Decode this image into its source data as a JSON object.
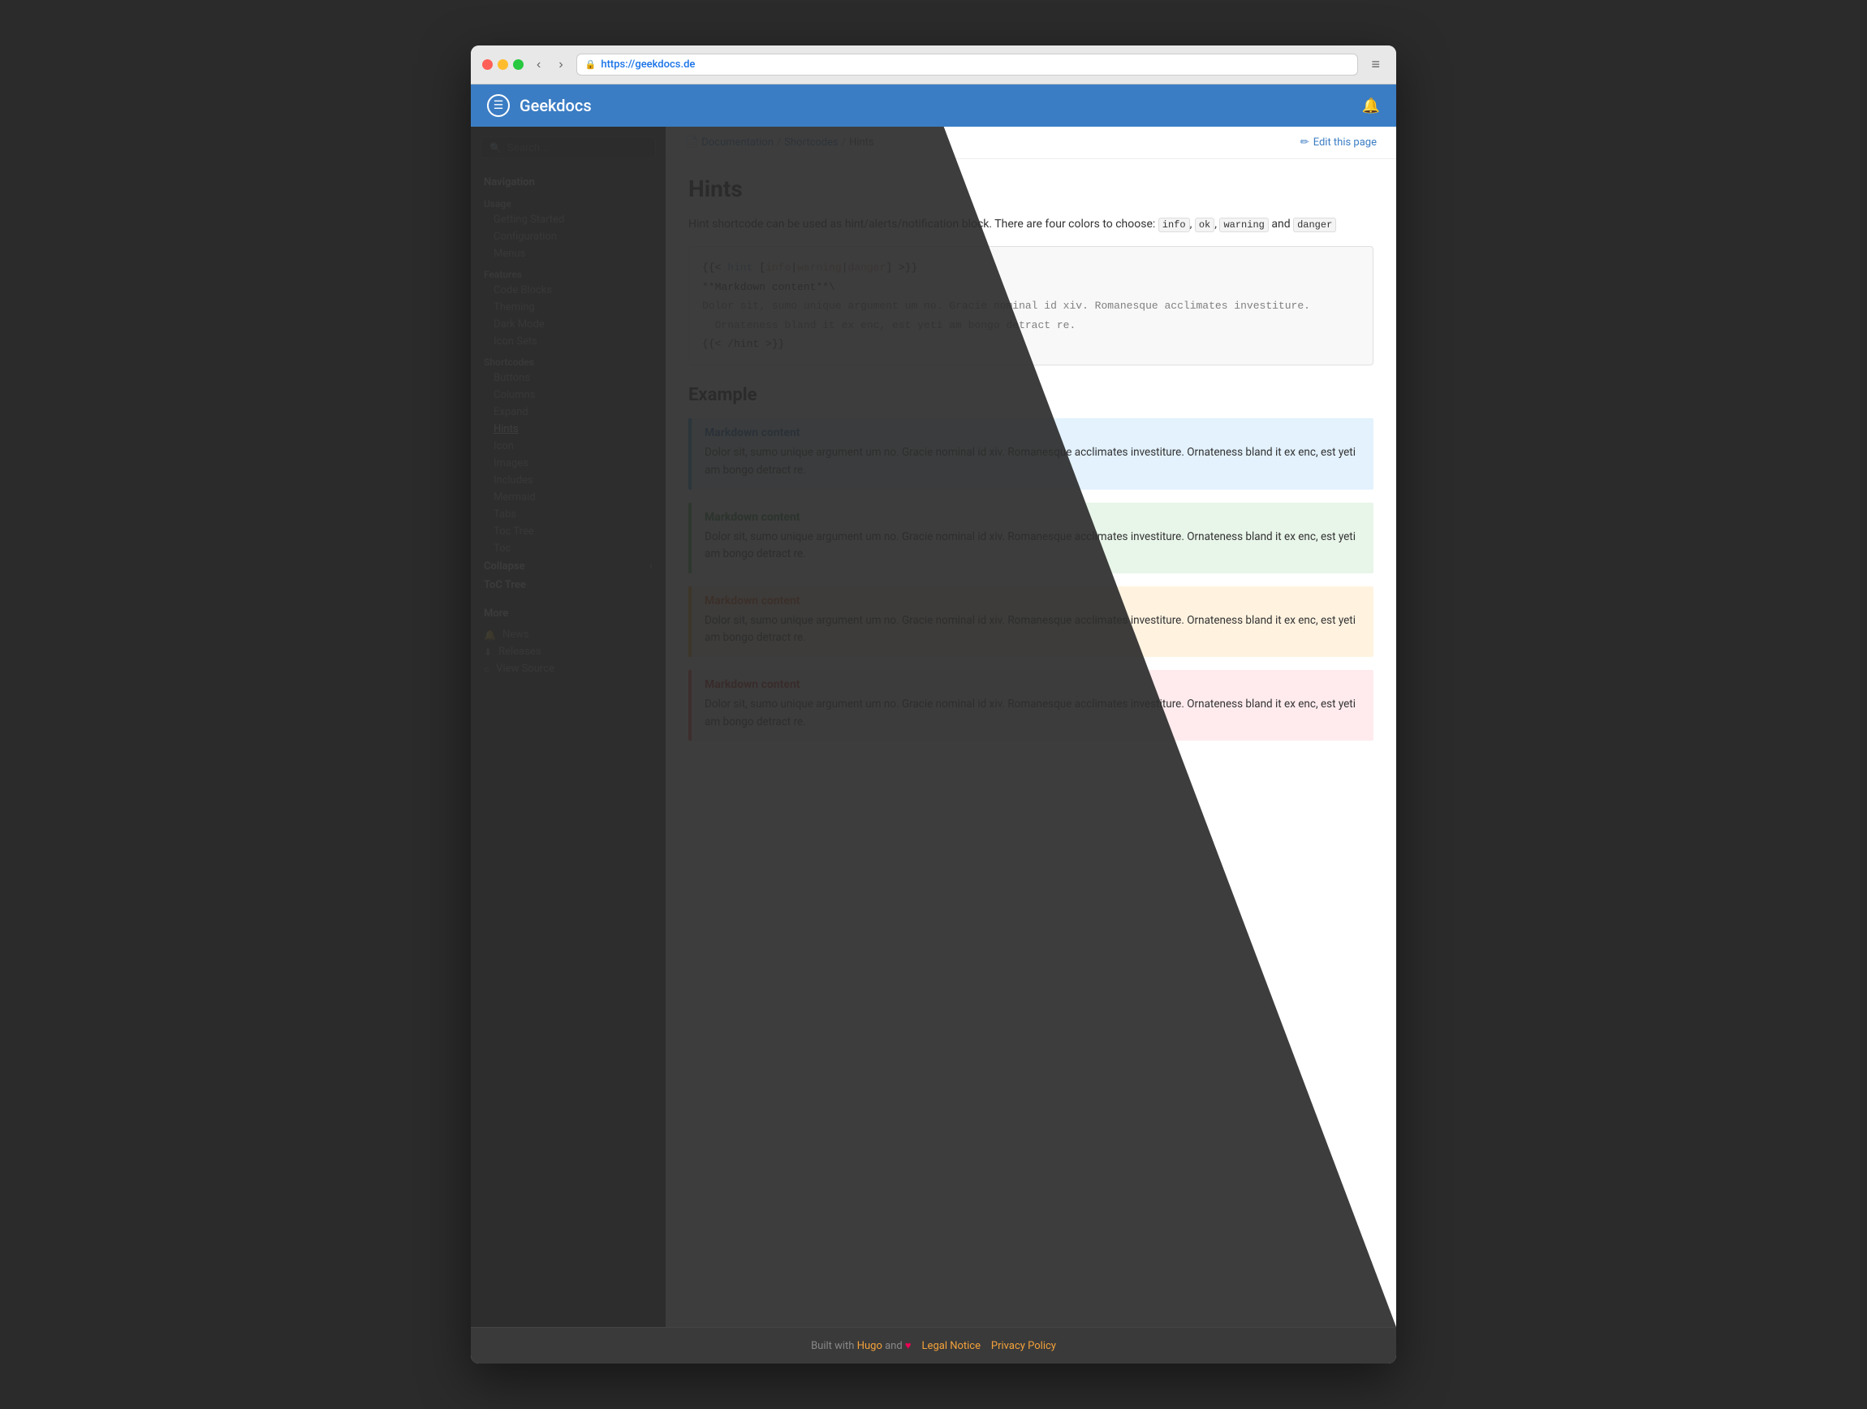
{
  "browser": {
    "url_prefix": "https://",
    "url_domain": "geekdocs.de",
    "menu_icon": "≡"
  },
  "topbar": {
    "site_icon": "☰",
    "site_title": "Geekdocs",
    "notification_icon": "🔔"
  },
  "sidebar": {
    "search_placeholder": "Search...",
    "nav_label": "Navigation",
    "usage_label": "Usage",
    "usage_items": [
      "Getting Started",
      "Configuration",
      "Menus"
    ],
    "features_label": "Features",
    "features_items": [
      "Code Blocks",
      "Theming",
      "Dark Mode",
      "Icon Sets"
    ],
    "shortcodes_label": "Shortcodes",
    "shortcodes_items": [
      "Buttons",
      "Columns",
      "Expand",
      "Hints",
      "Icon",
      "Images",
      "Includes",
      "Mermaid",
      "Tabs",
      "Toc Tree",
      "Toc"
    ],
    "collapse_label": "Collapse",
    "toc_tree_label": "ToC Tree",
    "more_label": "More",
    "more_items": [
      {
        "icon": "🔔",
        "label": "News"
      },
      {
        "icon": "⬇",
        "label": "Releases"
      },
      {
        "icon": "○",
        "label": "View Source"
      }
    ]
  },
  "breadcrumb": {
    "doc_link": "Documentation",
    "shortcodes_link": "Shortcodes",
    "current": "Hints",
    "edit_label": "Edit this page",
    "edit_icon": "✏"
  },
  "content": {
    "page_title": "Hints",
    "intro": "Hint shortcode can be used as hint/alerts/notification block. There are four colors to choose:",
    "inline_codes": [
      "info",
      "ok",
      "warning",
      "danger"
    ],
    "code_block": [
      "{{< hint [info|warning|danger] >}}",
      "**Markdown content**\\",
      "Dolor sit, sumo unique argument um no. Gracie nominal id xiv. Romanesque acclimates investiture.",
      "  Ornateness bland it ex enc, est yeti am bongo detract re.",
      "{{< /hint >}}"
    ],
    "example_heading": "Example",
    "hints": [
      {
        "type": "info",
        "title": "Markdown content",
        "body": "Dolor sit, sumo unique argument um no. Gracie nominal id xiv. Romanesque acclimates investiture. Ornateness bland it ex enc, est yeti am bongo detract re."
      },
      {
        "type": "ok",
        "title": "Markdown content",
        "body": "Dolor sit, sumo unique argument um no. Gracie nominal id xiv. Romanesque acclimates investiture. Ornateness bland it ex enc, est yeti am bongo detract re."
      },
      {
        "type": "warning",
        "title": "Markdown content",
        "body": "Dolor sit, sumo unique argument um no. Gracie nominal id xiv. Romanesque acclimates investiture. Ornateness bland it ex enc, est yeti am bongo detract re."
      },
      {
        "type": "danger",
        "title": "Markdown content",
        "body": "Dolor sit, sumo unique argument um no. Gracie nominal id xiv. Romanesque acclimates investiture. Ornateness bland it ex enc, est yeti am bongo detract re."
      }
    ]
  },
  "footer": {
    "text": "Built with",
    "hugo_link": "Hugo",
    "and": "and",
    "heart": "♥",
    "legal_link": "Legal Notice",
    "privacy_link": "Privacy Policy"
  }
}
